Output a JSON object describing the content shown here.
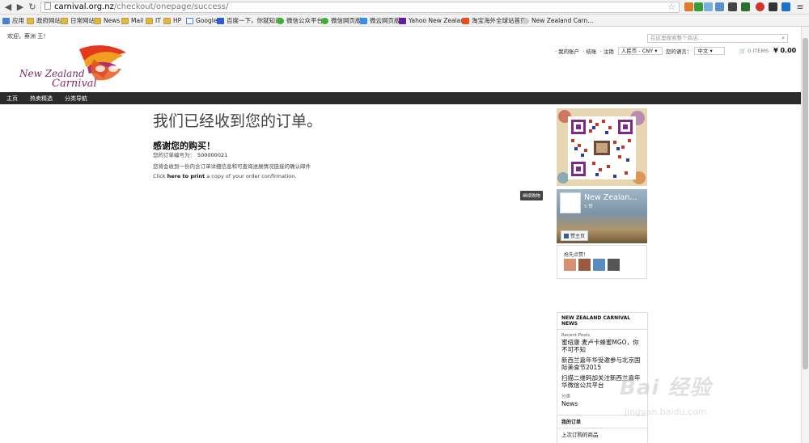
{
  "browser": {
    "url_domain": "carnival.org.nz",
    "url_path": "/checkout/onepage/success/",
    "bookmarks": [
      "应用",
      "政府网站",
      "日常网站",
      "News",
      "Mail",
      "IT",
      "HP",
      "Google",
      "百度一下，你就知道",
      "微信公众平台",
      "微信网页版",
      "微云网页版",
      "Yahoo New Zealand",
      "淘宝海外全球站首页",
      "New Zealand Carn..."
    ]
  },
  "header": {
    "welcome": "欢迎，蔡洲 王！",
    "search_placeholder": "在这里搜索整个商店...",
    "links": [
      "我的账户",
      "结账",
      "注销"
    ],
    "currency": "人民币 - CNY",
    "language_label": "您的语言：",
    "language": "中文",
    "cart_items": "0 ITEMS",
    "cart_total": "¥ 0.00"
  },
  "nav": [
    "主页",
    "热卖精选",
    "分类导航"
  ],
  "content": {
    "title": "我们已经收到您的订单。",
    "thanks": "感谢您的购买！",
    "order_label": "您的订单编号为：",
    "order_number": "500000021",
    "email_note": "您将会收到一份内含订单详细信息和可查询进展情况链接的确认邮件",
    "print_prefix": "Click",
    "print_link": "here to print",
    "print_suffix": "a copy of your order confirmation.",
    "continue_button": "继续购物"
  },
  "sidebar": {
    "fb_name": "New Zealan...",
    "fb_likes": "5 赞",
    "fb_like_button": "赞主页",
    "fb_faces_label": "抢先点赞！",
    "news_title": "NEW ZEALAND CARNIVAL NEWS",
    "recent_posts_label": "Recent Posts",
    "posts": [
      "蜜纽康 麦卢卡蜂蜜MGO，你不可不知",
      "新西兰嘉年华受邀参与北京国际美食节2015",
      "扫描二维码加关注新西兰嘉年华微信公共平台"
    ],
    "category_label": "分类",
    "category_value": "News",
    "orders_title": "我的订单",
    "orders_last": "上次订购的商品"
  },
  "watermark": {
    "text": "Bai 经验",
    "url": "jingyan.baidu.com"
  },
  "colors": {
    "nav_bg": "#2b2b2b",
    "text": "#444444",
    "fb_blue": "#3b5998"
  }
}
